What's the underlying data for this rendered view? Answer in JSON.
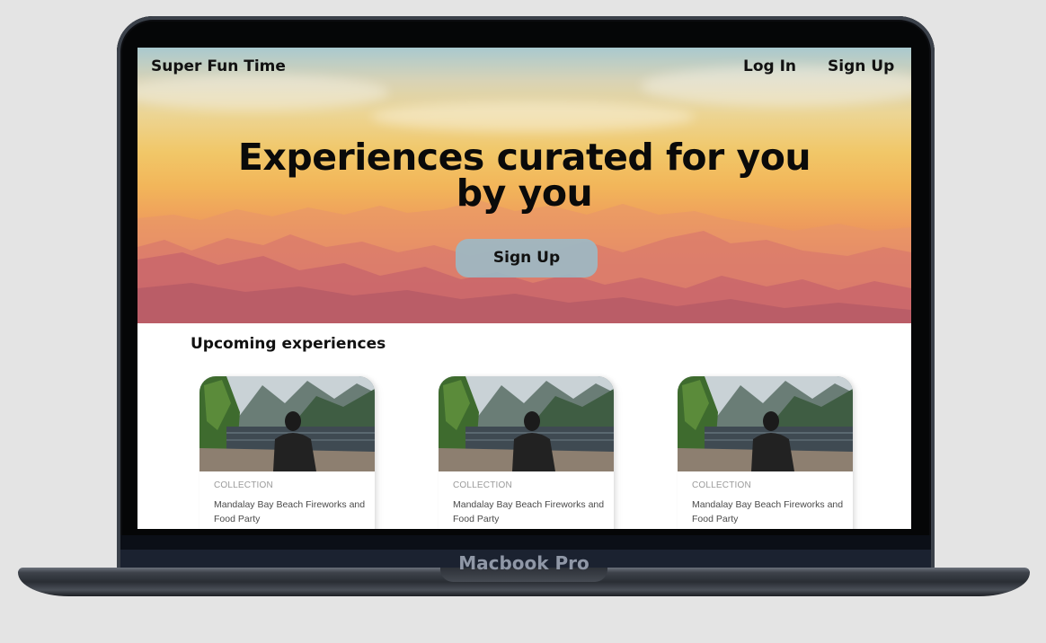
{
  "device": {
    "label": "Macbook Pro"
  },
  "header": {
    "brand": "Super Fun Time",
    "nav": [
      {
        "label": "Log In"
      },
      {
        "label": "Sign Up"
      }
    ]
  },
  "hero": {
    "title_line_1": "Experiences curated for you",
    "title_line_2": "by you",
    "cta_label": "Sign Up"
  },
  "experiences": {
    "heading": "Upcoming experiences",
    "cards": [
      {
        "tag": "COLLECTION",
        "title": "Mandalay Bay Beach Fireworks and Food Party"
      },
      {
        "tag": "COLLECTION",
        "title": "Mandalay Bay Beach Fireworks and Food Party"
      },
      {
        "tag": "COLLECTION",
        "title": "Mandalay Bay Beach Fireworks and Food Party"
      }
    ]
  },
  "colors": {
    "page_background": "#e4e4e4",
    "cta_background": "#9cb8c4",
    "text_dark": "#111111",
    "card_tag": "#9a9a9a"
  }
}
